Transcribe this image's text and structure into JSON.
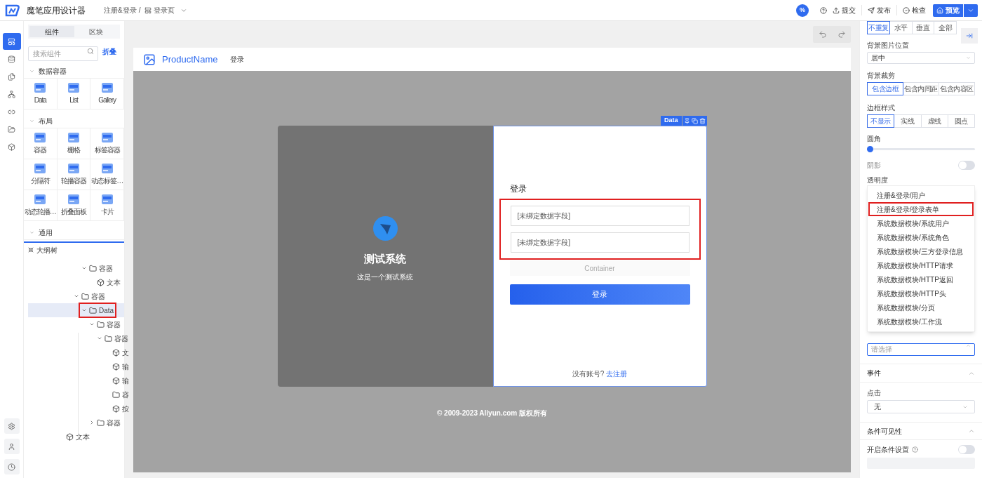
{
  "app": {
    "title": "魔笔应用设计器",
    "breadcrumb": [
      "注册&登录",
      "/"
    ],
    "page": "登录页"
  },
  "topbar": {
    "badge": "%",
    "actions": [
      {
        "kind": "help"
      },
      {
        "kind": "submit",
        "label": "提交"
      },
      {
        "kind": "publish",
        "label": "发布"
      },
      {
        "kind": "check",
        "label": "检查"
      }
    ],
    "preview": "预览"
  },
  "rail": {
    "items": [
      {
        "kind": "layout",
        "selected": true
      },
      {
        "kind": "database",
        "selected": false
      },
      {
        "kind": "pages",
        "selected": false
      },
      {
        "kind": "tree",
        "selected": false
      },
      {
        "kind": "link",
        "selected": false
      },
      {
        "kind": "folder",
        "selected": false
      },
      {
        "kind": "box",
        "selected": false
      }
    ],
    "bottom": [
      {
        "kind": "settings"
      },
      {
        "kind": "user"
      },
      {
        "kind": "clock"
      }
    ]
  },
  "components": {
    "tabs": [
      {
        "label": "组件",
        "selected": true
      },
      {
        "label": "区块",
        "selected": false
      }
    ],
    "search": {
      "placeholder": "搜索组件"
    },
    "collapse": "折叠",
    "groups": [
      {
        "title": "数据容器",
        "expanded": true,
        "items": [
          "Data",
          "List",
          "Gallery"
        ]
      },
      {
        "title": "布局",
        "expanded": true,
        "items": [
          "容器",
          "栅格",
          "标签容器",
          "分隔符",
          "轮播容器",
          "动态标签…",
          "动态轮播…",
          "折叠面板",
          "卡片"
        ]
      },
      {
        "title": "通用",
        "expanded": true
      }
    ]
  },
  "outline": {
    "title": "大纲树",
    "sections": [
      [
        {
          "label": "容器",
          "kind": "folder",
          "expanded": true,
          "highlighted": false,
          "children": [
            {
              "label": "文本",
              "kind": "leaf",
              "highlighted": false
            }
          ]
        }
      ],
      [
        {
          "label": "容器",
          "kind": "folder",
          "expanded": true,
          "highlighted": false,
          "children": [
            {
              "label": "Data",
              "kind": "folder",
              "expanded": true,
              "highlighted": true,
              "children": [
                {
                  "label": "容器",
                  "kind": "folder",
                  "expanded": true,
                  "highlighted": false,
                  "children": [
                    {
                      "label": "容器",
                      "kind": "folder",
                      "expanded": true,
                      "highlighted": false,
                      "children": [
                        {
                          "label": "文",
                          "kind": "leaf",
                          "highlighted": false
                        },
                        {
                          "label": "输",
                          "kind": "leaf",
                          "highlighted": false
                        },
                        {
                          "label": "输",
                          "kind": "leaf",
                          "highlighted": false
                        },
                        {
                          "label": "容",
                          "kind": "folder",
                          "highlighted": false
                        },
                        {
                          "label": "按",
                          "kind": "leaf",
                          "highlighted": false
                        }
                      ]
                    }
                  ]
                },
                {
                  "label": "容器",
                  "kind": "folder",
                  "expanded": false,
                  "highlighted": false
                }
              ]
            }
          ]
        }
      ],
      [
        {
          "label": "文本",
          "kind": "leaf",
          "highlighted": false
        }
      ]
    ]
  },
  "canvas": {
    "brand": "ProductName",
    "nav": "登录",
    "system": {
      "name": "测试系统",
      "subtitle": "这是一个测试系统"
    },
    "selection": {
      "label": "Data"
    },
    "form": {
      "title": "登录",
      "highlighted": true,
      "fields": [
        {
          "placeholder": "[未绑定数据字段]"
        },
        {
          "placeholder": "[未绑定数据字段]"
        }
      ],
      "container": "Container",
      "submit": "登录",
      "signup_prompt": "没有账号?",
      "signup_link": "去注册"
    },
    "footer": "© 2009-2023 Aliyun.com 版权所有"
  },
  "props": {
    "repeat": {
      "options": [
        {
          "label": "不重复",
          "selected": true
        },
        {
          "label": "水平",
          "selected": false
        },
        {
          "label": "垂直",
          "selected": false
        },
        {
          "label": "全部",
          "selected": false
        }
      ]
    },
    "position": {
      "label": "背景图片位置",
      "value": "居中"
    },
    "clip": {
      "label": "背景裁剪",
      "options": [
        {
          "label": "包含边框",
          "selected": true
        },
        {
          "label": "包含内间距",
          "selected": false
        },
        {
          "label": "包含内容区",
          "selected": false
        }
      ]
    },
    "border": {
      "label": "边框样式",
      "options": [
        {
          "label": "不显示",
          "selected": true
        },
        {
          "label": "实线",
          "selected": false
        },
        {
          "label": "虚线",
          "selected": false
        },
        {
          "label": "圆点",
          "selected": false
        }
      ]
    },
    "radius": {
      "label": "圆角",
      "level": 0
    },
    "shadow": {
      "label": "阴影",
      "on": false
    },
    "opacity": {
      "label": "透明度"
    },
    "dropdown": [
      {
        "label": "注册&登录/用户",
        "highlighted": false
      },
      {
        "label": "注册&登录/登录表单",
        "highlighted": true
      },
      {
        "label": "系统数据模块/系统用户",
        "highlighted": false
      },
      {
        "label": "系统数据模块/系统角色",
        "highlighted": false
      },
      {
        "label": "系统数据模块/三方登录信息",
        "highlighted": false
      },
      {
        "label": "系统数据模块/HTTP请求",
        "highlighted": false
      },
      {
        "label": "系统数据模块/HTTP返回",
        "highlighted": false
      },
      {
        "label": "系统数据模块/HTTP头",
        "highlighted": false
      },
      {
        "label": "系统数据模块/分页",
        "highlighted": false
      },
      {
        "label": "系统数据模块/工作流",
        "highlighted": false
      }
    ],
    "datasource": {
      "placeholder": "请选择"
    },
    "events": {
      "title": "事件",
      "label": "点击",
      "value": "无"
    },
    "visibility": {
      "title": "条件可见性",
      "label": "开启条件设置",
      "on": false
    }
  }
}
